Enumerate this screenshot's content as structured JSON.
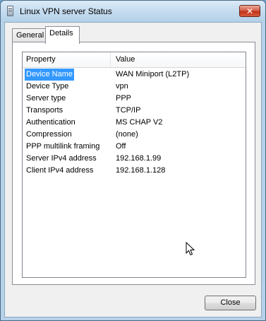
{
  "window": {
    "title": "Linux VPN server Status",
    "close_glyph": "✕"
  },
  "tabs": [
    {
      "label": "General",
      "active": false
    },
    {
      "label": "Details",
      "active": true
    }
  ],
  "details": {
    "columns": {
      "property": "Property",
      "value": "Value"
    },
    "rows": [
      {
        "property": "Device Name",
        "value": "WAN Miniport (L2TP)",
        "selected": true
      },
      {
        "property": "Device Type",
        "value": "vpn"
      },
      {
        "property": "Server type",
        "value": "PPP"
      },
      {
        "property": "Transports",
        "value": "TCP/IP"
      },
      {
        "property": "Authentication",
        "value": "MS CHAP V2"
      },
      {
        "property": "Compression",
        "value": "(none)"
      },
      {
        "property": "PPP multilink framing",
        "value": "Off"
      },
      {
        "property": "Server IPv4 address",
        "value": "192.168.1.99"
      },
      {
        "property": "Client IPv4 address",
        "value": "192.168.1.128"
      }
    ]
  },
  "buttons": {
    "close_label": "Close"
  },
  "colors": {
    "selection": "#3399ff",
    "title_close": "#c0331b"
  }
}
